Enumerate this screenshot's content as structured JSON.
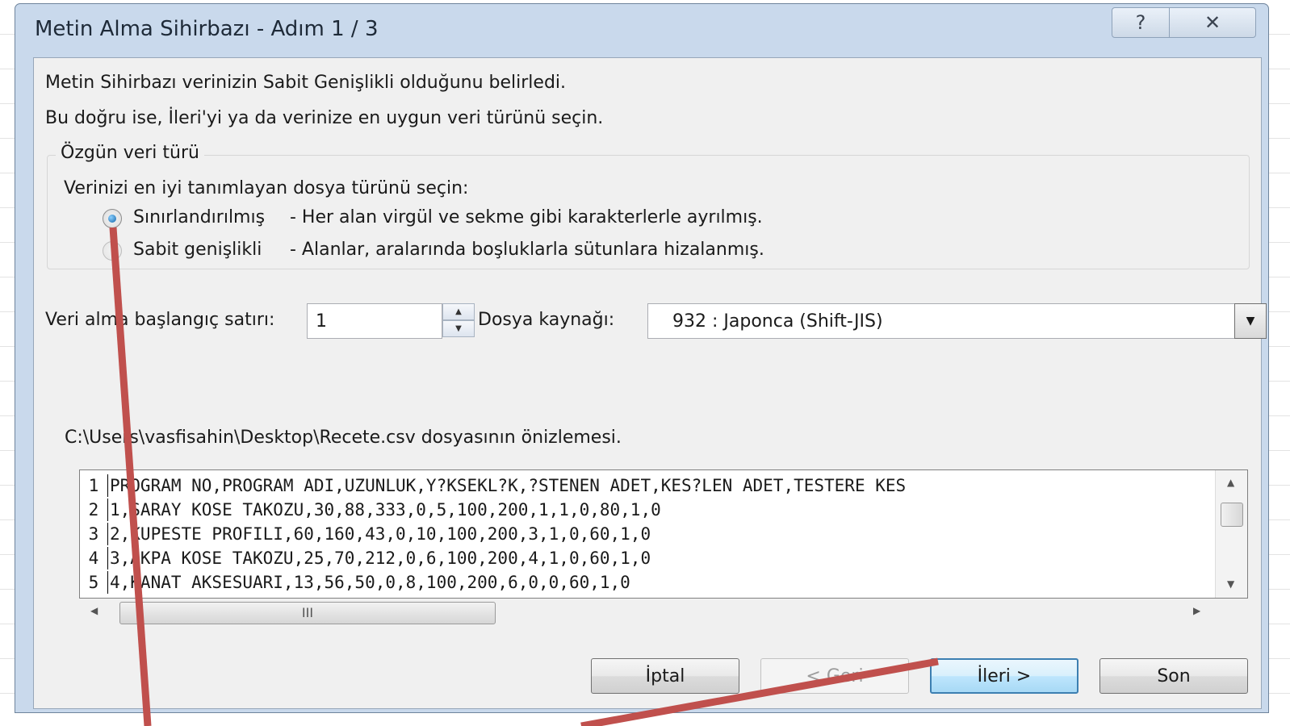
{
  "window": {
    "title": "Metin Alma Sihirbazı - Adım 1 / 3",
    "help_glyph": "?",
    "close_glyph": "✕"
  },
  "intro": {
    "line1": "Metin Sihirbazı verinizin Sabit Genişlikli olduğunu belirledi.",
    "line2": "Bu doğru ise, İleri'yi ya da verinize en uygun veri türünü seçin."
  },
  "original_type": {
    "legend": "Özgün veri türü",
    "prompt": "Verinizi en iyi tanımlayan dosya türünü seçin:",
    "options": [
      {
        "label": "Sınırlandırılmış",
        "desc": "- Her alan virgül ve sekme gibi karakterlerle ayrılmış.",
        "selected": true
      },
      {
        "label": "Sabit genişlikli",
        "desc": "- Alanlar, aralarında boşluklarla sütunlara hizalanmış.",
        "selected": false
      }
    ]
  },
  "start_row": {
    "label": "Veri alma başlangıç satırı:",
    "value": "1"
  },
  "file_origin": {
    "label": "Dosya kaynağı:",
    "value": "932 : Japonca (Shift-JIS)"
  },
  "preview": {
    "label": "C:\\Users\\vasfisahin\\Desktop\\Recete.csv dosyasının önizlemesi.",
    "rows": [
      {
        "num": "1",
        "text": "PROGRAM NO,PROGRAM ADI,UZUNLUK,Y?KSEKL?K,?STENEN ADET,KES?LEN ADET,TESTERE KES"
      },
      {
        "num": "2",
        "text": "1,SARAY KOSE TAKOZU,30,88,333,0,5,100,200,1,1,0,80,1,0"
      },
      {
        "num": "3",
        "text": "2,KUPESTE PROFILI,60,160,43,0,10,100,200,3,1,0,60,1,0"
      },
      {
        "num": "4",
        "text": "3,AKPA KOSE TAKOZU,25,70,212,0,6,100,200,4,1,0,60,1,0"
      },
      {
        "num": "5",
        "text": "4,KANAT AKSESUARI,13,56,50,0,8,100,200,6,0,0,60,1,0"
      }
    ],
    "hthumb_glyph": "III"
  },
  "buttons": {
    "cancel": "İptal",
    "back": "< Geri",
    "next": "İleri >",
    "finish": "Son"
  },
  "colors": {
    "annotation_arrow": "#c0504d",
    "accent_radio": "#1264a8"
  }
}
